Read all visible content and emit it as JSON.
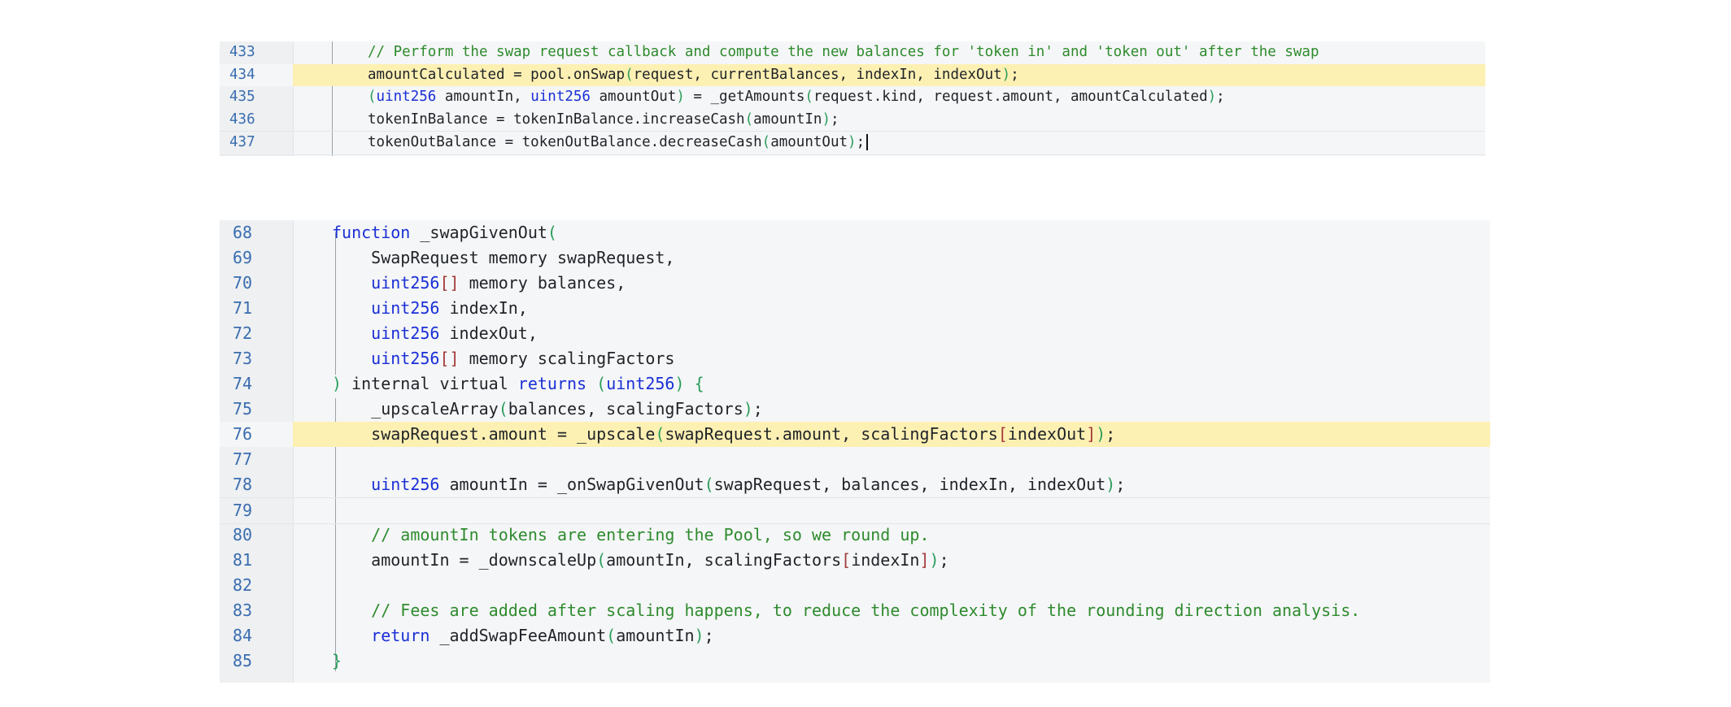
{
  "panel_1": {
    "lines": [
      {
        "num": "433",
        "highlight": false,
        "tokens": [
          {
            "t": "// Perform the swap request callback and compute the new balances for 'token in' and 'token out' after the swap",
            "c": "cm"
          }
        ]
      },
      {
        "num": "434",
        "highlight": true,
        "tokens": [
          {
            "t": "amountCalculated = pool.onSwap",
            "c": "pl"
          },
          {
            "t": "(",
            "c": "br"
          },
          {
            "t": "request, currentBalances, indexIn, indexOut",
            "c": "pl"
          },
          {
            "t": ")",
            "c": "br"
          },
          {
            "t": ";",
            "c": "pl"
          }
        ]
      },
      {
        "num": "435",
        "highlight": false,
        "tokens": [
          {
            "t": "(",
            "c": "br"
          },
          {
            "t": "uint256",
            "c": "kw"
          },
          {
            "t": " amountIn, ",
            "c": "pl"
          },
          {
            "t": "uint256",
            "c": "kw"
          },
          {
            "t": " amountOut",
            "c": "pl"
          },
          {
            "t": ")",
            "c": "br"
          },
          {
            "t": " = _getAmounts",
            "c": "pl"
          },
          {
            "t": "(",
            "c": "br"
          },
          {
            "t": "request.kind, request.amount, amountCalculated",
            "c": "pl"
          },
          {
            "t": ")",
            "c": "br"
          },
          {
            "t": ";",
            "c": "pl"
          }
        ]
      },
      {
        "num": "436",
        "highlight": false,
        "tokens": [
          {
            "t": "tokenInBalance = tokenInBalance.increaseCash",
            "c": "pl"
          },
          {
            "t": "(",
            "c": "br"
          },
          {
            "t": "amountIn",
            "c": "pl"
          },
          {
            "t": ")",
            "c": "br"
          },
          {
            "t": ";",
            "c": "pl"
          }
        ]
      },
      {
        "num": "437",
        "highlight": false,
        "current": true,
        "tokens": [
          {
            "t": "tokenOutBalance = tokenOutBalance.decreaseCash",
            "c": "pl"
          },
          {
            "t": "(",
            "c": "br"
          },
          {
            "t": "amountOut",
            "c": "pl"
          },
          {
            "t": ")",
            "c": "br"
          },
          {
            "t": ";",
            "c": "pl"
          }
        ]
      }
    ]
  },
  "panel_2": {
    "lines": [
      {
        "num": "68",
        "highlight": false,
        "tokens": [
          {
            "t": "function",
            "c": "kw"
          },
          {
            "t": " _swapGivenOut",
            "c": "pl"
          },
          {
            "t": "(",
            "c": "br"
          }
        ]
      },
      {
        "num": "69",
        "highlight": false,
        "tokens": [
          {
            "t": "    SwapRequest memory swapRequest,",
            "c": "pl"
          }
        ]
      },
      {
        "num": "70",
        "highlight": false,
        "tokens": [
          {
            "t": "    ",
            "c": "pl"
          },
          {
            "t": "uint256",
            "c": "kw"
          },
          {
            "t": "[]",
            "c": "bk"
          },
          {
            "t": " memory balances,",
            "c": "pl"
          }
        ]
      },
      {
        "num": "71",
        "highlight": false,
        "tokens": [
          {
            "t": "    ",
            "c": "pl"
          },
          {
            "t": "uint256",
            "c": "kw"
          },
          {
            "t": " indexIn,",
            "c": "pl"
          }
        ]
      },
      {
        "num": "72",
        "highlight": false,
        "tokens": [
          {
            "t": "    ",
            "c": "pl"
          },
          {
            "t": "uint256",
            "c": "kw"
          },
          {
            "t": " indexOut,",
            "c": "pl"
          }
        ]
      },
      {
        "num": "73",
        "highlight": false,
        "tokens": [
          {
            "t": "    ",
            "c": "pl"
          },
          {
            "t": "uint256",
            "c": "kw"
          },
          {
            "t": "[]",
            "c": "bk"
          },
          {
            "t": " memory scalingFactors",
            "c": "pl"
          }
        ]
      },
      {
        "num": "74",
        "highlight": false,
        "tokens": [
          {
            "t": ")",
            "c": "br"
          },
          {
            "t": " internal virtual ",
            "c": "pl"
          },
          {
            "t": "returns",
            "c": "kw"
          },
          {
            "t": " ",
            "c": "pl"
          },
          {
            "t": "(",
            "c": "br"
          },
          {
            "t": "uint256",
            "c": "kw"
          },
          {
            "t": ")",
            "c": "br"
          },
          {
            "t": " ",
            "c": "pl"
          },
          {
            "t": "{",
            "c": "br"
          }
        ]
      },
      {
        "num": "75",
        "highlight": false,
        "tokens": [
          {
            "t": "    _upscaleArray",
            "c": "pl"
          },
          {
            "t": "(",
            "c": "br"
          },
          {
            "t": "balances, scalingFactors",
            "c": "pl"
          },
          {
            "t": ")",
            "c": "br"
          },
          {
            "t": ";",
            "c": "pl"
          }
        ]
      },
      {
        "num": "76",
        "highlight": true,
        "tokens": [
          {
            "t": "    swapRequest.amount = _upscale",
            "c": "pl"
          },
          {
            "t": "(",
            "c": "br"
          },
          {
            "t": "swapRequest.amount, scalingFactors",
            "c": "pl"
          },
          {
            "t": "[",
            "c": "bk"
          },
          {
            "t": "indexOut",
            "c": "pl"
          },
          {
            "t": "]",
            "c": "bk"
          },
          {
            "t": ")",
            "c": "br"
          },
          {
            "t": ";",
            "c": "pl"
          }
        ]
      },
      {
        "num": "77",
        "highlight": false,
        "tokens": []
      },
      {
        "num": "78",
        "highlight": false,
        "tokens": [
          {
            "t": "    ",
            "c": "pl"
          },
          {
            "t": "uint256",
            "c": "kw"
          },
          {
            "t": " amountIn = _onSwapGivenOut",
            "c": "pl"
          },
          {
            "t": "(",
            "c": "br"
          },
          {
            "t": "swapRequest, balances, indexIn, indexOut",
            "c": "pl"
          },
          {
            "t": ")",
            "c": "br"
          },
          {
            "t": ";",
            "c": "pl"
          }
        ]
      },
      {
        "num": "79",
        "highlight": false,
        "current": true,
        "tokens": []
      },
      {
        "num": "80",
        "highlight": false,
        "tokens": [
          {
            "t": "    // amountIn tokens are entering the Pool, so we round up.",
            "c": "cm"
          }
        ]
      },
      {
        "num": "81",
        "highlight": false,
        "tokens": [
          {
            "t": "    amountIn = _downscaleUp",
            "c": "pl"
          },
          {
            "t": "(",
            "c": "br"
          },
          {
            "t": "amountIn, scalingFactors",
            "c": "pl"
          },
          {
            "t": "[",
            "c": "bk"
          },
          {
            "t": "indexIn",
            "c": "pl"
          },
          {
            "t": "]",
            "c": "bk"
          },
          {
            "t": ")",
            "c": "br"
          },
          {
            "t": ";",
            "c": "pl"
          }
        ]
      },
      {
        "num": "82",
        "highlight": false,
        "tokens": []
      },
      {
        "num": "83",
        "highlight": false,
        "tokens": [
          {
            "t": "    // Fees are added after scaling happens, to reduce the complexity of the rounding direction analysis.",
            "c": "cm"
          }
        ]
      },
      {
        "num": "84",
        "highlight": false,
        "tokens": [
          {
            "t": "    ",
            "c": "pl"
          },
          {
            "t": "return",
            "c": "kw"
          },
          {
            "t": " _addSwapFeeAmount",
            "c": "pl"
          },
          {
            "t": "(",
            "c": "br"
          },
          {
            "t": "amountIn",
            "c": "pl"
          },
          {
            "t": ")",
            "c": "br"
          },
          {
            "t": ";",
            "c": "pl"
          }
        ]
      },
      {
        "num": "85",
        "highlight": false,
        "tokens": [
          {
            "t": "}",
            "c": "br"
          }
        ]
      }
    ]
  },
  "colors": {
    "keyword": "#1a2fd6",
    "comment": "#2e8b2e",
    "bracket": "#2a9d5c",
    "square_bracket": "#a33a3a",
    "line_number": "#3a6db0",
    "highlight": "#fdf0b3",
    "panel_bg": "#f5f6f7"
  }
}
